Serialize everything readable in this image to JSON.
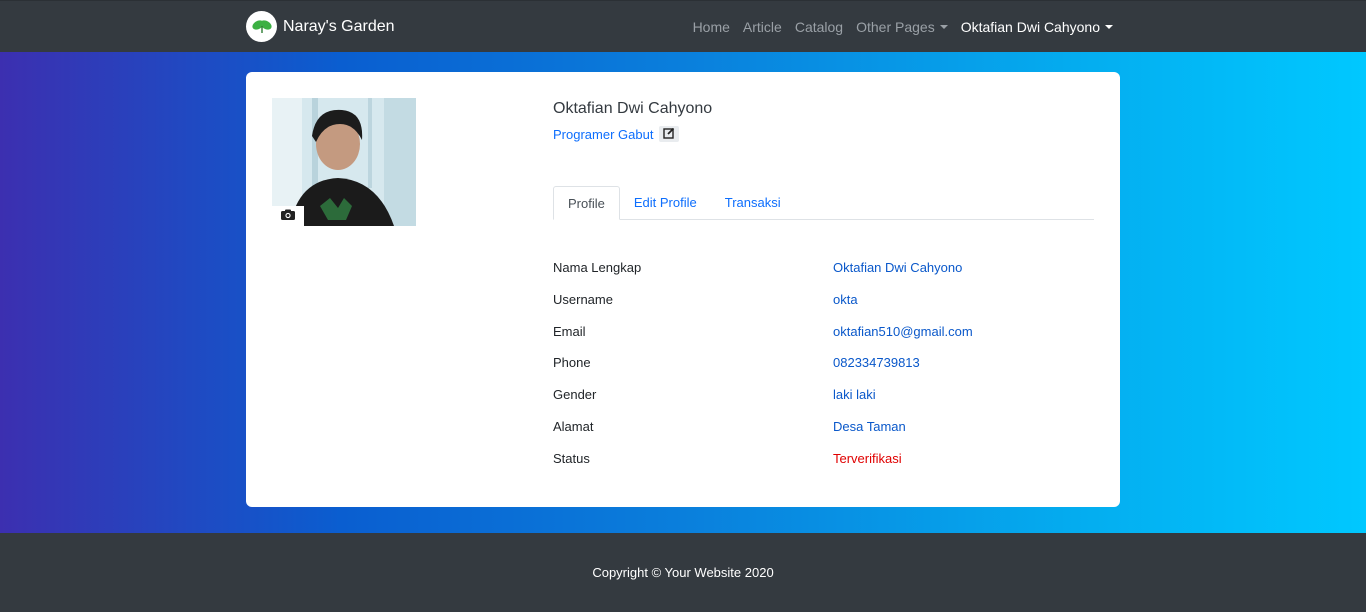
{
  "navbar": {
    "brand": "Naray's Garden",
    "links": [
      "Home",
      "Article",
      "Catalog",
      "Other Pages"
    ],
    "user": "Oktafian Dwi Cahyono"
  },
  "profile": {
    "name": "Oktafian Dwi Cahyono",
    "role": "Programer Gabut",
    "tabs": [
      "Profile",
      "Edit Profile",
      "Transaksi"
    ],
    "fields": [
      {
        "label": "Nama Lengkap",
        "value": "Oktafian Dwi Cahyono"
      },
      {
        "label": "Username",
        "value": "okta"
      },
      {
        "label": "Email",
        "value": "oktafian510@gmail.com"
      },
      {
        "label": "Phone",
        "value": "082334739813"
      },
      {
        "label": "Gender",
        "value": "laki laki"
      },
      {
        "label": "Alamat",
        "value": "Desa Taman"
      },
      {
        "label": "Status",
        "value": "Terverifikasi"
      }
    ]
  },
  "footer": {
    "copyright": "Copyright © Your Website 2020"
  },
  "colors": {
    "accent": "#0d6efd",
    "status_verified": "#e00000",
    "navbar": "#343a40"
  },
  "icons": {
    "logo": "plant-logo-icon",
    "camera": "camera-icon",
    "edit": "edit-icon"
  }
}
